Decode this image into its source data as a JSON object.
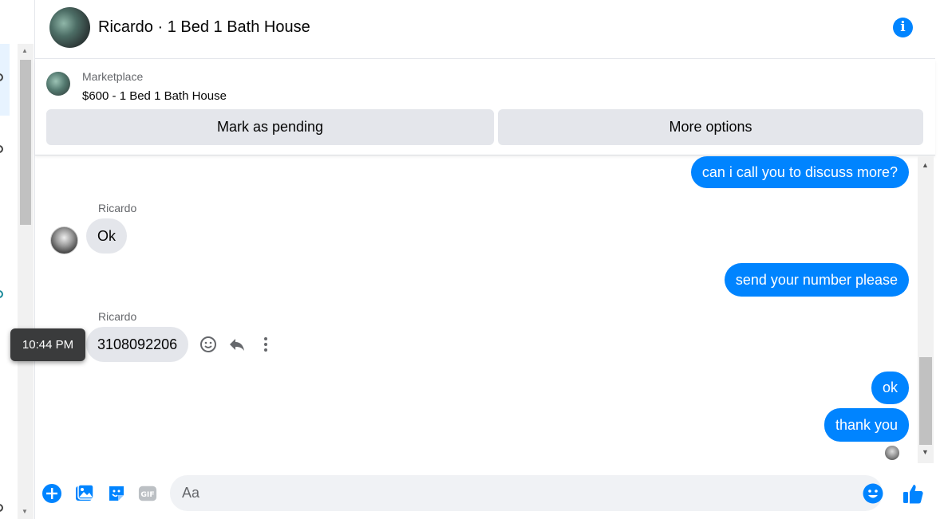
{
  "header": {
    "title": "Ricardo · 1 Bed 1 Bath House",
    "info_icon": "info-icon",
    "accent": "#0084ff"
  },
  "marketplace": {
    "label": "Marketplace",
    "listing": "$600 - 1 Bed 1 Bath House",
    "mark_pending": "Mark as pending",
    "more_options": "More options"
  },
  "messages": [
    {
      "direction": "out",
      "text": "can i call you to discuss more?"
    },
    {
      "direction": "in",
      "sender": "Ricardo",
      "text": "Ok"
    },
    {
      "direction": "out",
      "text": "send your number please"
    },
    {
      "direction": "in",
      "sender": "Ricardo",
      "text": "3108092206"
    },
    {
      "direction": "out",
      "text": "ok"
    },
    {
      "direction": "out",
      "text": "thank you"
    }
  ],
  "tooltip": "10:44 PM",
  "message_actions": [
    "smile-icon",
    "reply-icon",
    "more-vertical-icon"
  ],
  "composer": {
    "placeholder": "Aa",
    "icons": [
      "plus-icon",
      "image-icon",
      "sticker-icon",
      "gif-icon",
      "emoji-icon",
      "thumbs-up-icon"
    ],
    "gif_label": "GIF"
  }
}
